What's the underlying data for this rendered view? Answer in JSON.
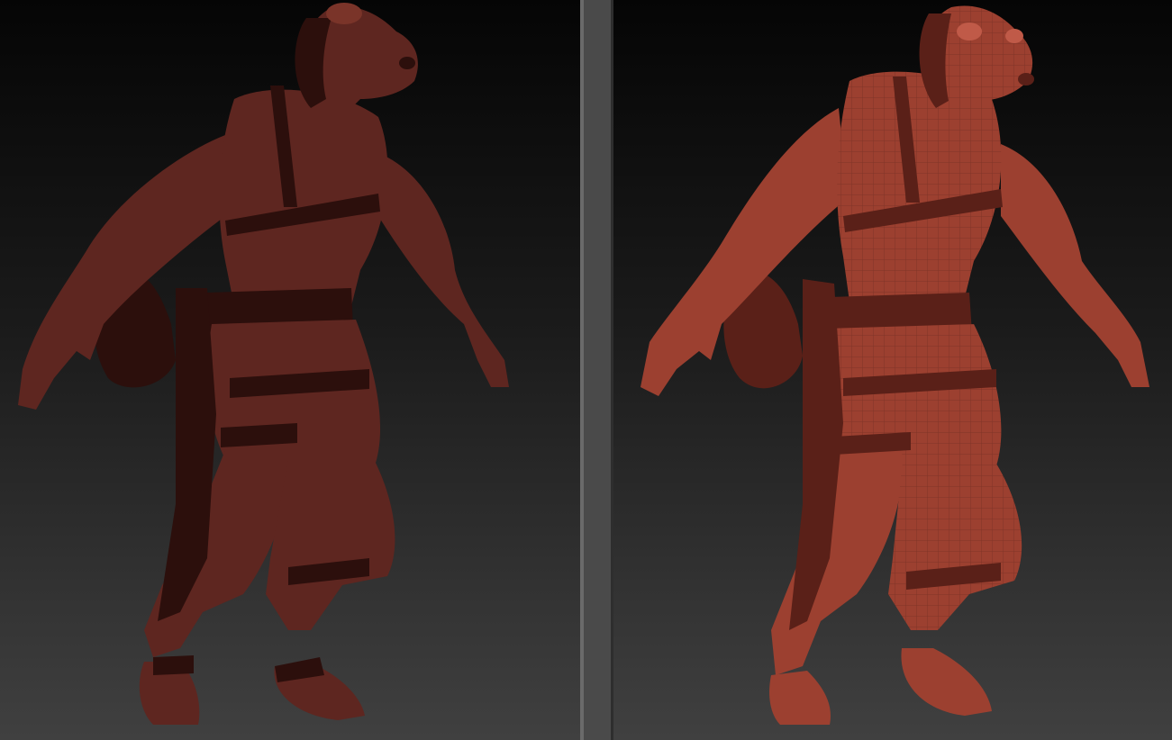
{
  "viewports": [
    {
      "id": "left",
      "model": "sculpted-dog-character-model",
      "material_color": "#5e2620",
      "shadow_color": "#2c0f0c",
      "highlight_color": "#7a3429"
    },
    {
      "id": "right",
      "model": "polyframe-dog-character-model",
      "material_color": "#9c4030",
      "shadow_color": "#5a2018",
      "highlight_color": "#c05a48"
    }
  ],
  "colors": {
    "background_top": "#050505",
    "background_bottom": "#404040",
    "divider": "#4a4a4a"
  }
}
